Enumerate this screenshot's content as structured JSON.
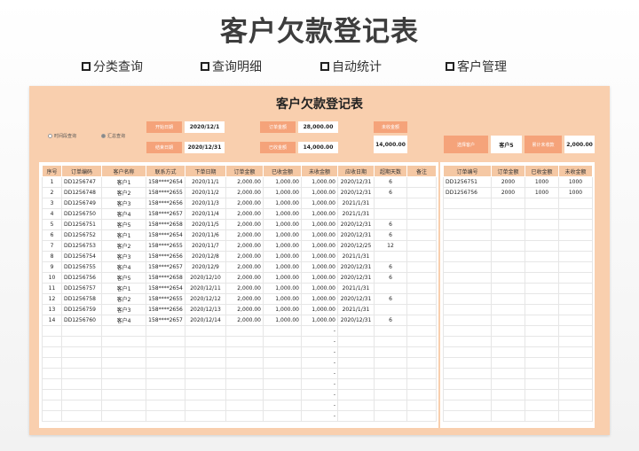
{
  "page_title": "客户欠款登记表",
  "features": [
    {
      "label": "分类查询"
    },
    {
      "label": "查询明细"
    },
    {
      "label": "自动统计"
    },
    {
      "label": "客户管理"
    }
  ],
  "sheet": {
    "title": "客户欠款登记表",
    "radio_time": "时间段查询",
    "radio_summary": "汇总查询",
    "start_date_label": "开始日期",
    "start_date": "2020/12/1",
    "end_date_label": "结束日期",
    "end_date": "2020/12/31",
    "order_amount_label": "订单金额",
    "order_amount": "28,000.00",
    "received_label": "已收金额",
    "received": "14,000.00",
    "unreceived_label": "未收金额",
    "unreceived": "14,000.00",
    "customer_select_label": "选择客户",
    "customer_select": "客户5",
    "customer_total_label": "累计未收款",
    "customer_total": "2,000.00"
  },
  "main_table": {
    "headers": [
      "序号",
      "订单编码",
      "客户名称",
      "联系方式",
      "下单日期",
      "订单金额",
      "已收金额",
      "未收金额",
      "应收日期",
      "超期天数",
      "备注"
    ],
    "rows": [
      [
        "1",
        "DD1256747",
        "客户1",
        "158****2654",
        "2020/11/1",
        "2,000.00",
        "1,000.00",
        "1,000.00",
        "2020/12/31",
        "6",
        ""
      ],
      [
        "2",
        "DD1256748",
        "客户2",
        "158****2655",
        "2020/11/2",
        "2,000.00",
        "1,000.00",
        "1,000.00",
        "2020/12/31",
        "6",
        ""
      ],
      [
        "3",
        "DD1256749",
        "客户3",
        "158****2656",
        "2020/11/3",
        "2,000.00",
        "1,000.00",
        "1,000.00",
        "2021/1/31",
        "",
        ""
      ],
      [
        "4",
        "DD1256750",
        "客户4",
        "158****2657",
        "2020/11/4",
        "2,000.00",
        "1,000.00",
        "1,000.00",
        "2021/1/31",
        "",
        ""
      ],
      [
        "5",
        "DD1256751",
        "客户5",
        "158****2658",
        "2020/11/5",
        "2,000.00",
        "1,000.00",
        "1,000.00",
        "2020/12/31",
        "6",
        ""
      ],
      [
        "6",
        "DD1256752",
        "客户1",
        "158****2654",
        "2020/11/6",
        "2,000.00",
        "1,000.00",
        "1,000.00",
        "2020/12/31",
        "6",
        ""
      ],
      [
        "7",
        "DD1256753",
        "客户2",
        "158****2655",
        "2020/11/7",
        "2,000.00",
        "1,000.00",
        "1,000.00",
        "2020/12/25",
        "12",
        ""
      ],
      [
        "8",
        "DD1256754",
        "客户3",
        "158****2656",
        "2020/12/8",
        "2,000.00",
        "1,000.00",
        "1,000.00",
        "2021/1/31",
        "",
        ""
      ],
      [
        "9",
        "DD1256755",
        "客户4",
        "158****2657",
        "2020/12/9",
        "2,000.00",
        "1,000.00",
        "1,000.00",
        "2020/12/31",
        "6",
        ""
      ],
      [
        "10",
        "DD1256756",
        "客户5",
        "158****2658",
        "2020/12/10",
        "2,000.00",
        "1,000.00",
        "1,000.00",
        "2020/12/31",
        "6",
        ""
      ],
      [
        "11",
        "DD1256757",
        "客户1",
        "158****2654",
        "2020/12/11",
        "2,000.00",
        "1,000.00",
        "1,000.00",
        "2021/1/31",
        "",
        ""
      ],
      [
        "12",
        "DD1256758",
        "客户2",
        "158****2655",
        "2020/12/12",
        "2,000.00",
        "1,000.00",
        "1,000.00",
        "2020/12/31",
        "6",
        ""
      ],
      [
        "13",
        "DD1256759",
        "客户3",
        "158****2656",
        "2020/12/13",
        "2,000.00",
        "1,000.00",
        "1,000.00",
        "2021/1/31",
        "",
        ""
      ],
      [
        "14",
        "DD1256760",
        "客户4",
        "158****2657",
        "2020/12/14",
        "2,000.00",
        "1,000.00",
        "1,000.00",
        "2020/12/31",
        "6",
        ""
      ],
      [
        "",
        "",
        "",
        "",
        "",
        "",
        "",
        "-",
        "",
        "",
        ""
      ],
      [
        "",
        "",
        "",
        "",
        "",
        "",
        "",
        "-",
        "",
        "",
        ""
      ],
      [
        "",
        "",
        "",
        "",
        "",
        "",
        "",
        "-",
        "",
        "",
        ""
      ],
      [
        "",
        "",
        "",
        "",
        "",
        "",
        "",
        "-",
        "",
        "",
        ""
      ],
      [
        "",
        "",
        "",
        "",
        "",
        "",
        "",
        "-",
        "",
        "",
        ""
      ],
      [
        "",
        "",
        "",
        "",
        "",
        "",
        "",
        "-",
        "",
        "",
        ""
      ],
      [
        "",
        "",
        "",
        "",
        "",
        "",
        "",
        "-",
        "",
        "",
        ""
      ],
      [
        "",
        "",
        "",
        "",
        "",
        "",
        "",
        "-",
        "",
        "",
        ""
      ],
      [
        "",
        "",
        "",
        "",
        "",
        "",
        "",
        "-",
        "",
        "",
        ""
      ]
    ]
  },
  "side_table": {
    "headers": [
      "订单编号",
      "订单金额",
      "已收金额",
      "未收金额"
    ],
    "rows": [
      [
        "DD1256751",
        "2000",
        "1000",
        "1000"
      ],
      [
        "DD1256756",
        "2000",
        "1000",
        "1000"
      ],
      [
        "",
        "",
        "",
        ""
      ],
      [
        "",
        "",
        "",
        ""
      ],
      [
        "",
        "",
        "",
        ""
      ],
      [
        "",
        "",
        "",
        ""
      ],
      [
        "",
        "",
        "",
        ""
      ],
      [
        "",
        "",
        "",
        ""
      ],
      [
        "",
        "",
        "",
        ""
      ],
      [
        "",
        "",
        "",
        ""
      ],
      [
        "",
        "",
        "",
        ""
      ],
      [
        "",
        "",
        "",
        ""
      ],
      [
        "",
        "",
        "",
        ""
      ],
      [
        "",
        "",
        "",
        ""
      ],
      [
        "",
        "",
        "",
        ""
      ],
      [
        "",
        "",
        "",
        ""
      ],
      [
        "",
        "",
        "",
        ""
      ],
      [
        "",
        "",
        "",
        ""
      ],
      [
        "",
        "",
        "",
        ""
      ],
      [
        "",
        "",
        "",
        ""
      ],
      [
        "",
        "",
        "",
        ""
      ],
      [
        "",
        "",
        "",
        ""
      ],
      [
        "",
        "",
        "",
        ""
      ]
    ]
  }
}
